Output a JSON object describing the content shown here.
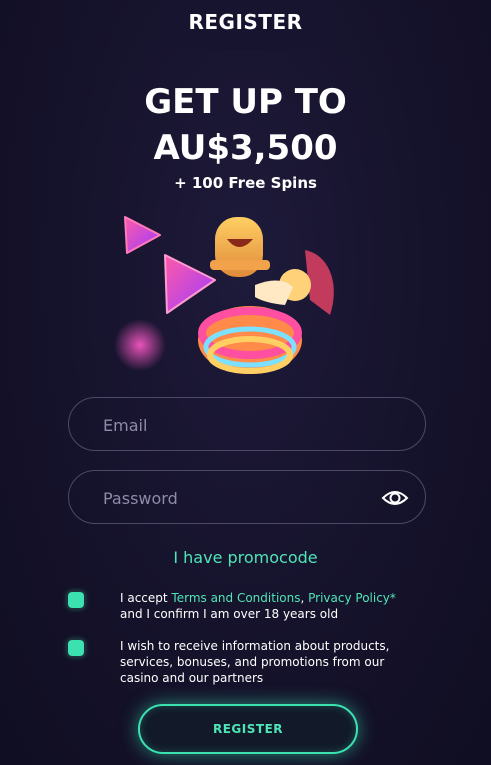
{
  "header": {
    "title": "REGISTER"
  },
  "bonus": {
    "line1": "GET UP TO",
    "line2": "AU$3,500",
    "sub": "+ 100 Free Spins"
  },
  "form": {
    "email_placeholder": "Email",
    "password_placeholder": "Password",
    "promo_link": "I have promocode",
    "terms": {
      "pre": "I accept ",
      "link1": "Terms and Conditions",
      "sep": ", ",
      "link2": "Privacy Policy*",
      "post": " and I confirm I am over 18 years old",
      "checked": true
    },
    "marketing": {
      "text": "I wish to receive information about products, services, bonuses, and promotions from our casino and our partners",
      "checked": true
    },
    "submit_label": "REGISTER"
  },
  "colors": {
    "background": "#13112a",
    "accent": "#4fe6b7",
    "checkbox": "#3be2b0",
    "field_border": "#4c4868"
  },
  "icons": {
    "password_toggle": "eye-icon",
    "hero": "mascot-illustration"
  }
}
